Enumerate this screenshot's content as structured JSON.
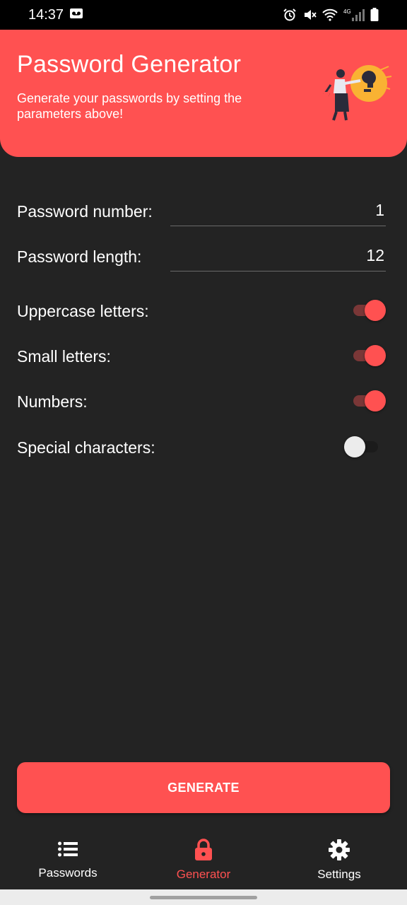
{
  "status_bar": {
    "time": "14:37",
    "icons": [
      "voicemail-icon",
      "alarm-icon",
      "mute-icon",
      "wifi-icon",
      "4g-signal-icon",
      "battery-icon"
    ],
    "network": "4G"
  },
  "header": {
    "title": "Password Generator",
    "subtitle": "Generate your passwords by setting the parameters above!",
    "illustration": "person-lightbulb-illustration"
  },
  "settings": {
    "password_number": {
      "label": "Password number:",
      "value": "1"
    },
    "password_length": {
      "label": "Password length:",
      "value": "12"
    },
    "uppercase": {
      "label": "Uppercase letters:",
      "enabled": true
    },
    "small": {
      "label": "Small letters:",
      "enabled": true
    },
    "numbers": {
      "label": "Numbers:",
      "enabled": true
    },
    "special": {
      "label": "Special characters:",
      "enabled": false
    }
  },
  "generate_button": {
    "label": "GENERATE"
  },
  "bottom_nav": {
    "items": [
      {
        "label": "Passwords",
        "icon": "list-icon",
        "active": false
      },
      {
        "label": "Generator",
        "icon": "lock-icon",
        "active": true
      },
      {
        "label": "Settings",
        "icon": "gear-icon",
        "active": false
      }
    ]
  },
  "colors": {
    "accent": "#FF5151",
    "background": "#232323",
    "text": "#FFFFFF"
  }
}
